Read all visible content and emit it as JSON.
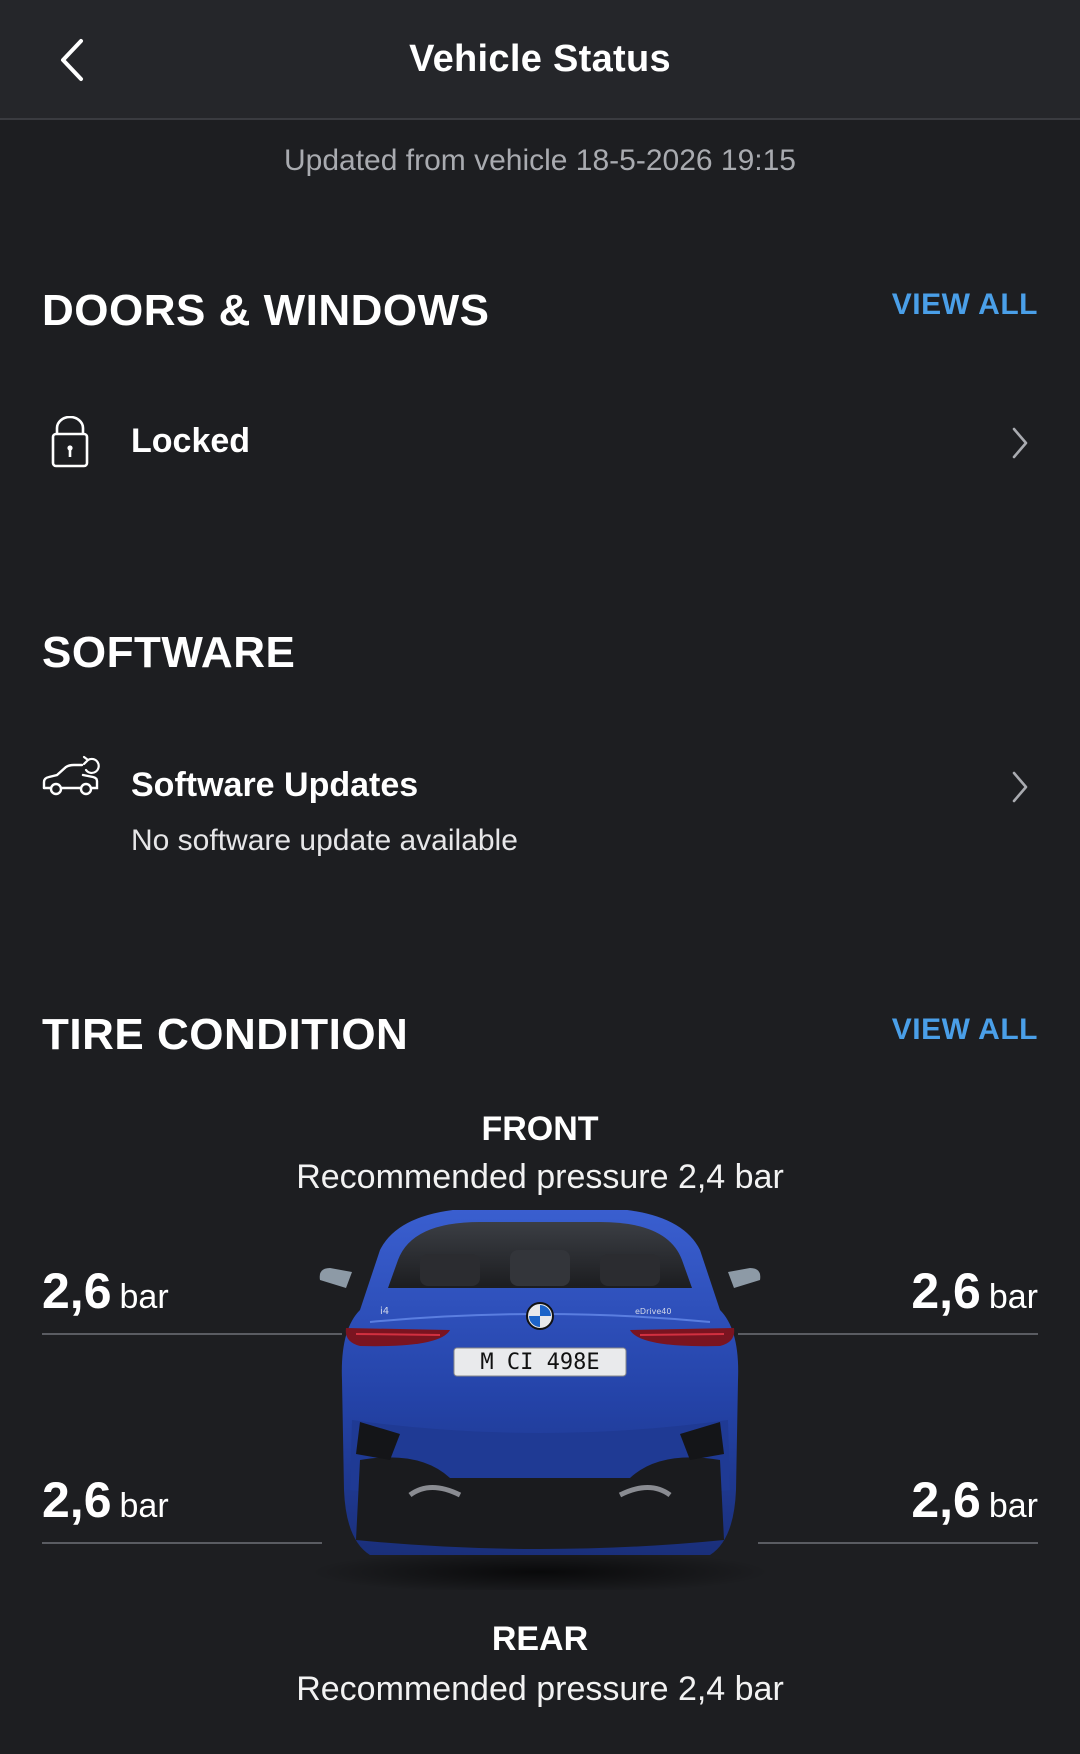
{
  "header": {
    "title": "Vehicle Status",
    "back_icon": "chevron-left-icon"
  },
  "updated_text": "Updated from vehicle 18-5-2026 19:15",
  "doors_windows": {
    "title": "DOORS & WINDOWS",
    "view_all": "VIEW ALL",
    "status_icon": "lock-icon",
    "status": "Locked"
  },
  "software": {
    "title": "SOFTWARE",
    "item_icon": "car-update-icon",
    "item_title": "Software Updates",
    "item_subtitle": "No software update available"
  },
  "tires": {
    "title": "TIRE CONDITION",
    "view_all": "VIEW ALL",
    "front_label": "FRONT",
    "front_recommended": "Recommended pressure 2,4 bar",
    "rear_label": "REAR",
    "rear_recommended": "Recommended pressure 2,4 bar",
    "front_left": {
      "value": "2,6",
      "unit": "bar"
    },
    "front_right": {
      "value": "2,6",
      "unit": "bar"
    },
    "rear_left": {
      "value": "2,6",
      "unit": "bar"
    },
    "rear_right": {
      "value": "2,6",
      "unit": "bar"
    },
    "car_badge_left": "i4",
    "car_badge_right": "eDrive40",
    "license_plate": "M CI 498E"
  },
  "colors": {
    "accent": "#4a9fe8",
    "background": "#1d1e21",
    "header": "#25262a",
    "car_body": "#2a4db0"
  }
}
